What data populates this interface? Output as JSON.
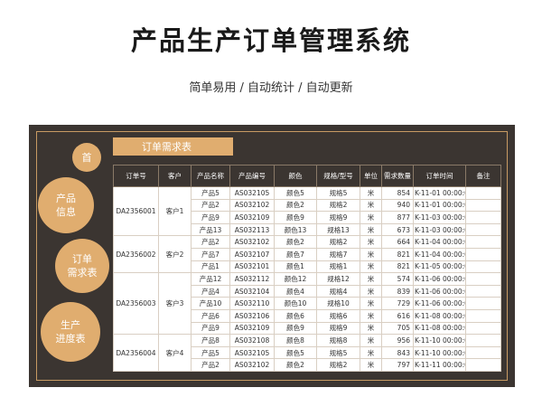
{
  "title": "产品生产订单管理系统",
  "subtitle": "简单易用 / 自动统计 / 自动更新",
  "nav": {
    "home": "首",
    "product": "产品\n信息",
    "demand": "订单\n需求表",
    "progress": "生产\n进度表"
  },
  "section_title": "订单需求表",
  "columns": [
    "订单号",
    "客户",
    "产品名称",
    "产品编号",
    "颜色",
    "规格/型号",
    "单位",
    "需求数量",
    "订单时间",
    "备注"
  ],
  "orders": [
    {
      "order_no": "DA2356001",
      "customer": "客户1",
      "items": [
        {
          "name": "产品5",
          "code": "AS032105",
          "color": "颜色5",
          "spec": "规格5",
          "unit": "米",
          "qty": "854",
          "time": "K-11-01 00:00:00",
          "note": ""
        },
        {
          "name": "产品2",
          "code": "AS032102",
          "color": "颜色2",
          "spec": "规格2",
          "unit": "米",
          "qty": "940",
          "time": "K-11-01 00:00:00",
          "note": ""
        },
        {
          "name": "产品9",
          "code": "AS032109",
          "color": "颜色9",
          "spec": "规格9",
          "unit": "米",
          "qty": "877",
          "time": "K-11-03 00:00:00",
          "note": ""
        },
        {
          "name": "产品13",
          "code": "AS032113",
          "color": "颜色13",
          "spec": "规格13",
          "unit": "米",
          "qty": "673",
          "time": "K-11-03 00:00:00",
          "note": ""
        }
      ]
    },
    {
      "order_no": "DA2356002",
      "customer": "客户2",
      "items": [
        {
          "name": "产品2",
          "code": "AS032102",
          "color": "颜色2",
          "spec": "规格2",
          "unit": "米",
          "qty": "664",
          "time": "K-11-04 00:00:00",
          "note": ""
        },
        {
          "name": "产品7",
          "code": "AS032107",
          "color": "颜色7",
          "spec": "规格7",
          "unit": "米",
          "qty": "821",
          "time": "K-11-04 00:00:00",
          "note": ""
        },
        {
          "name": "产品1",
          "code": "AS032101",
          "color": "颜色1",
          "spec": "规格1",
          "unit": "米",
          "qty": "821",
          "time": "K-11-05 00:00:00",
          "note": ""
        }
      ]
    },
    {
      "order_no": "DA2356003",
      "customer": "客户3",
      "items": [
        {
          "name": "产品12",
          "code": "AS032112",
          "color": "颜色12",
          "spec": "规格12",
          "unit": "米",
          "qty": "574",
          "time": "K-11-06 00:00:00",
          "note": ""
        },
        {
          "name": "产品4",
          "code": "AS032104",
          "color": "颜色4",
          "spec": "规格4",
          "unit": "米",
          "qty": "839",
          "time": "K-11-06 00:00:00",
          "note": ""
        },
        {
          "name": "产品10",
          "code": "AS032110",
          "color": "颜色10",
          "spec": "规格10",
          "unit": "米",
          "qty": "729",
          "time": "K-11-06 00:00:00",
          "note": ""
        },
        {
          "name": "产品6",
          "code": "AS032106",
          "color": "颜色6",
          "spec": "规格6",
          "unit": "米",
          "qty": "616",
          "time": "K-11-08 00:00:00",
          "note": ""
        },
        {
          "name": "产品9",
          "code": "AS032109",
          "color": "颜色9",
          "spec": "规格9",
          "unit": "米",
          "qty": "705",
          "time": "K-11-08 00:00:00",
          "note": ""
        }
      ]
    },
    {
      "order_no": "DA2356004",
      "customer": "客户4",
      "items": [
        {
          "name": "产品8",
          "code": "AS032108",
          "color": "颜色8",
          "spec": "规格8",
          "unit": "米",
          "qty": "956",
          "time": "K-11-10 00:00:00",
          "note": ""
        },
        {
          "name": "产品5",
          "code": "AS032105",
          "color": "颜色5",
          "spec": "规格5",
          "unit": "米",
          "qty": "843",
          "time": "K-11-10 00:00:00",
          "note": ""
        },
        {
          "name": "产品2",
          "code": "AS032102",
          "color": "颜色2",
          "spec": "规格2",
          "unit": "米",
          "qty": "797",
          "time": "K-11-11 00:00:00",
          "note": ""
        }
      ]
    }
  ],
  "colors": {
    "panel": "#3b3531",
    "accent": "#e0ad6f",
    "border": "#c79a63"
  }
}
